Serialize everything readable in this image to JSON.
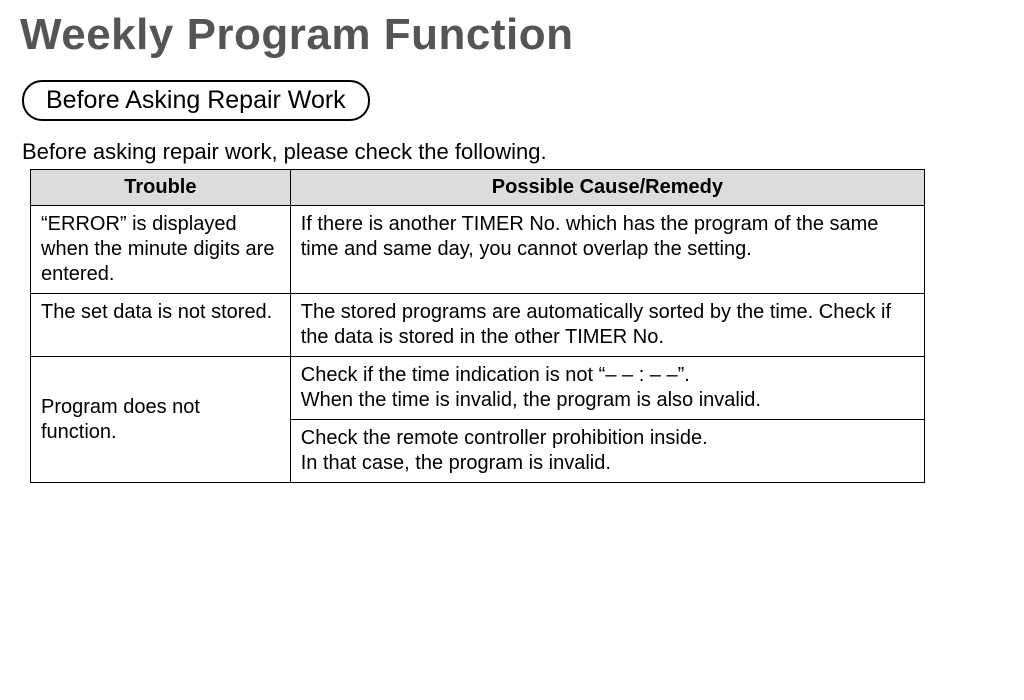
{
  "title": "Weekly Program Function",
  "section_header": "Before Asking Repair Work",
  "intro": "Before asking repair work, please check the following.",
  "table": {
    "headers": {
      "trouble": "Trouble",
      "remedy": "Possible Cause/Remedy"
    },
    "rows": [
      {
        "trouble": "“ERROR” is displayed when the minute digits are entered.",
        "remedy": "If there is another TIMER No. which has the program of the same time and same day, you cannot overlap the setting."
      },
      {
        "trouble": "The set data is not stored.",
        "remedy": "The stored programs are automatically sorted by the time. Check if the data is stored in the other TIMER No."
      },
      {
        "trouble": "Program does not function.",
        "remedy": "Check if the time indication is not “– – : – –”.\nWhen the time is invalid, the program is also invalid."
      },
      {
        "trouble": "",
        "remedy": "Check the remote controller prohibition inside.\nIn that case, the program is invalid."
      }
    ]
  }
}
